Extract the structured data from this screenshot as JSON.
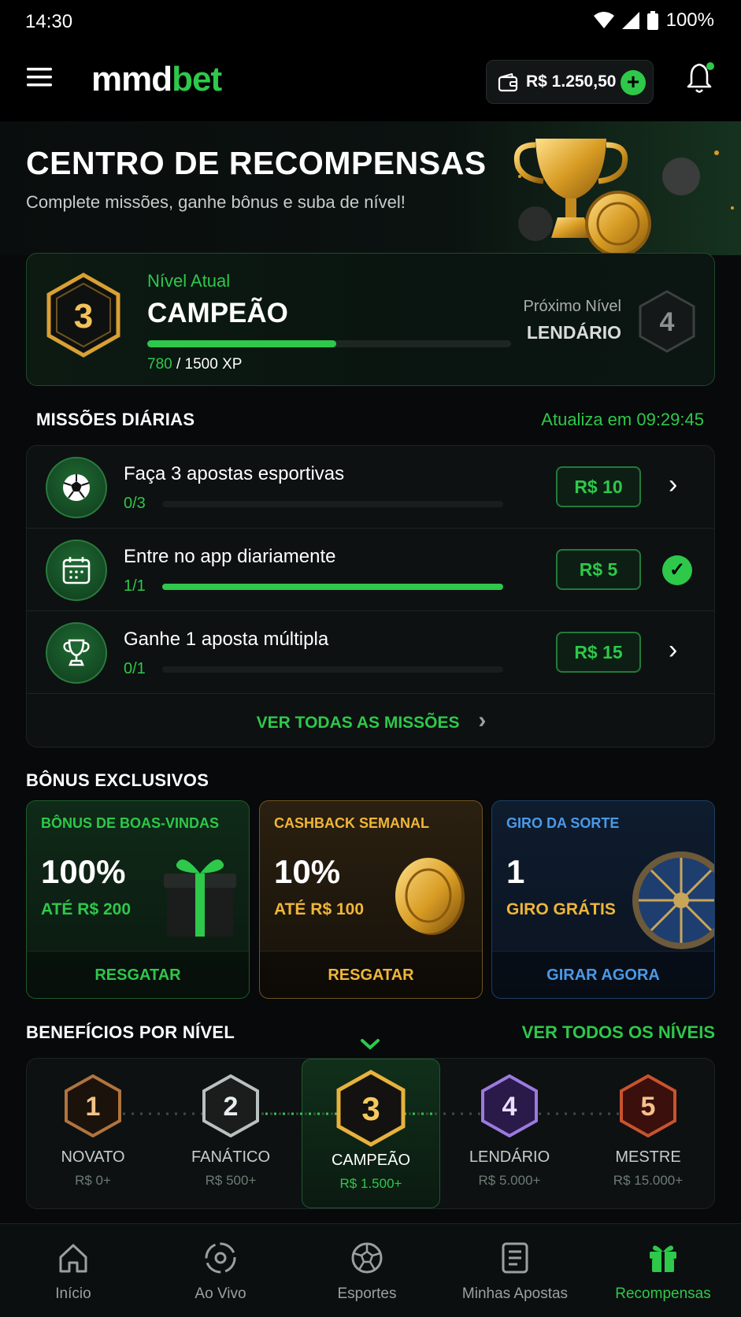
{
  "status": {
    "time": "14:30",
    "battery": "100%"
  },
  "header": {
    "logo_main": "mmd",
    "logo_accent": "bet",
    "balance": "R$ 1.250,50"
  },
  "hero": {
    "title": "CENTRO DE RECOMPENSAS",
    "subtitle": "Complete missões, ganhe bônus e suba de nível!"
  },
  "level": {
    "current_number": "3",
    "label": "Nível Atual",
    "name": "CAMPEÃO",
    "xp_current": "780",
    "xp_total": "/ 1500 XP",
    "progress": 0.52,
    "next_label": "Próximo Nível",
    "next_name": "LENDÁRIO",
    "next_number": "4"
  },
  "missions": {
    "title": "MISSÕES DIÁRIAS",
    "refresh": "Atualiza em 09:29:45",
    "items": [
      {
        "icon": "soccer-ball-icon",
        "title": "Faça 3 apostas esportivas",
        "count": "0/3",
        "progress": 0,
        "reward": "R$ 10",
        "state": "open"
      },
      {
        "icon": "calendar-icon",
        "title": "Entre no app diariamente",
        "count": "1/1",
        "progress": 1,
        "reward": "R$ 5",
        "state": "done"
      },
      {
        "icon": "trophy-icon",
        "title": "Ganhe 1 aposta múltipla",
        "count": "0/1",
        "progress": 0,
        "reward": "R$ 15",
        "state": "open"
      }
    ],
    "see_all": "VER TODAS AS MISSÕES"
  },
  "bonus": {
    "title": "BÔNUS EXCLUSIVOS",
    "cards": [
      {
        "tag": "BÔNUS DE BOAS-VINDAS",
        "big": "100%",
        "sub": "ATÉ R$ 200",
        "action": "RESGATAR",
        "accent": "#2ec84a"
      },
      {
        "tag": "CASHBACK SEMANAL",
        "big": "10%",
        "sub": "ATÉ R$ 100",
        "action": "RESGATAR",
        "accent": "#f0b63a"
      },
      {
        "tag": "GIRO DA SORTE",
        "big": "1",
        "sub": "GIRO GRÁTIS",
        "action": "GIRAR AGORA",
        "accent": "#4a9ae8"
      }
    ]
  },
  "benefits": {
    "title": "BENEFÍCIOS POR NÍVEL",
    "see_all": "VER TODOS OS NÍVEIS",
    "levels": [
      {
        "num": "1",
        "name": "NOVATO",
        "req": "R$ 0+"
      },
      {
        "num": "2",
        "name": "FANÁTICO",
        "req": "R$ 500+"
      },
      {
        "num": "3",
        "name": "CAMPEÃO",
        "req": "R$ 1.500+"
      },
      {
        "num": "4",
        "name": "LENDÁRIO",
        "req": "R$ 5.000+"
      },
      {
        "num": "5",
        "name": "MESTRE",
        "req": "R$ 15.000+"
      }
    ]
  },
  "nav": {
    "items": [
      {
        "label": "Início",
        "icon": "home-icon"
      },
      {
        "label": "Ao Vivo",
        "icon": "live-icon"
      },
      {
        "label": "Esportes",
        "icon": "soccer-ball-icon"
      },
      {
        "label": "Minhas Apostas",
        "icon": "betslip-icon"
      },
      {
        "label": "Recompensas",
        "icon": "gift-icon"
      }
    ],
    "active": "Recompensas"
  },
  "colors": {
    "accent_green": "#2ec84a",
    "gold": "#f0b63a",
    "blue": "#4a9ae8",
    "background": "#07090a"
  }
}
